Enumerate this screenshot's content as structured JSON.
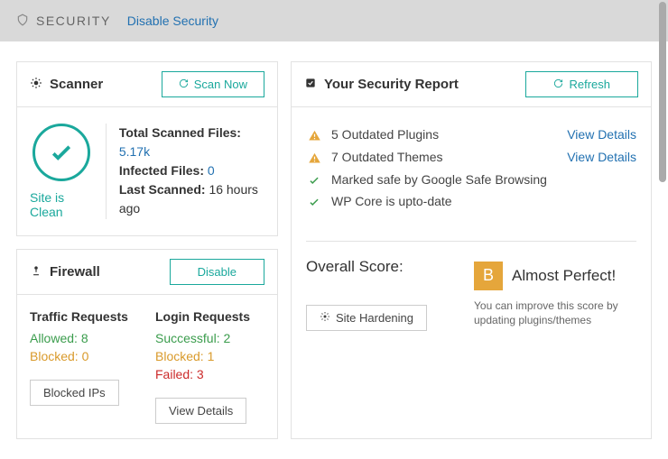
{
  "topbar": {
    "title": "SECURITY",
    "disable_link": "Disable Security"
  },
  "scanner": {
    "title": "Scanner",
    "scan_btn": "Scan Now",
    "status": "Site is Clean",
    "total_label": "Total Scanned Files:",
    "total_value": "5.17k",
    "infected_label": "Infected Files:",
    "infected_value": "0",
    "last_label": "Last Scanned:",
    "last_value": "16 hours ago"
  },
  "firewall": {
    "title": "Firewall",
    "disable_btn": "Disable",
    "traffic_head": "Traffic Requests",
    "login_head": "Login Requests",
    "traffic": {
      "allowed_label": "Allowed:",
      "allowed_value": "8",
      "blocked_label": "Blocked:",
      "blocked_value": "0"
    },
    "login": {
      "success_label": "Successful:",
      "success_value": "2",
      "blocked_label": "Blocked:",
      "blocked_value": "1",
      "failed_label": "Failed:",
      "failed_value": "3"
    },
    "blocked_ips_btn": "Blocked IPs",
    "view_details_btn": "View Details"
  },
  "report": {
    "title": "Your Security Report",
    "refresh_btn": "Refresh",
    "items": [
      {
        "count": "5",
        "text": "Outdated Plugins",
        "type": "warn",
        "link": "View Details"
      },
      {
        "count": "7",
        "text": "Outdated Themes",
        "type": "warn",
        "link": "View Details"
      },
      {
        "text": "Marked safe by Google Safe Browsing",
        "type": "ok"
      },
      {
        "text": "WP Core is upto-date",
        "type": "ok"
      }
    ],
    "score_label": "Overall Score:",
    "hardening_btn": "Site Hardening",
    "grade": "B",
    "almost": "Almost Perfect!",
    "improve": "You can improve this score by updating plugins/themes"
  }
}
